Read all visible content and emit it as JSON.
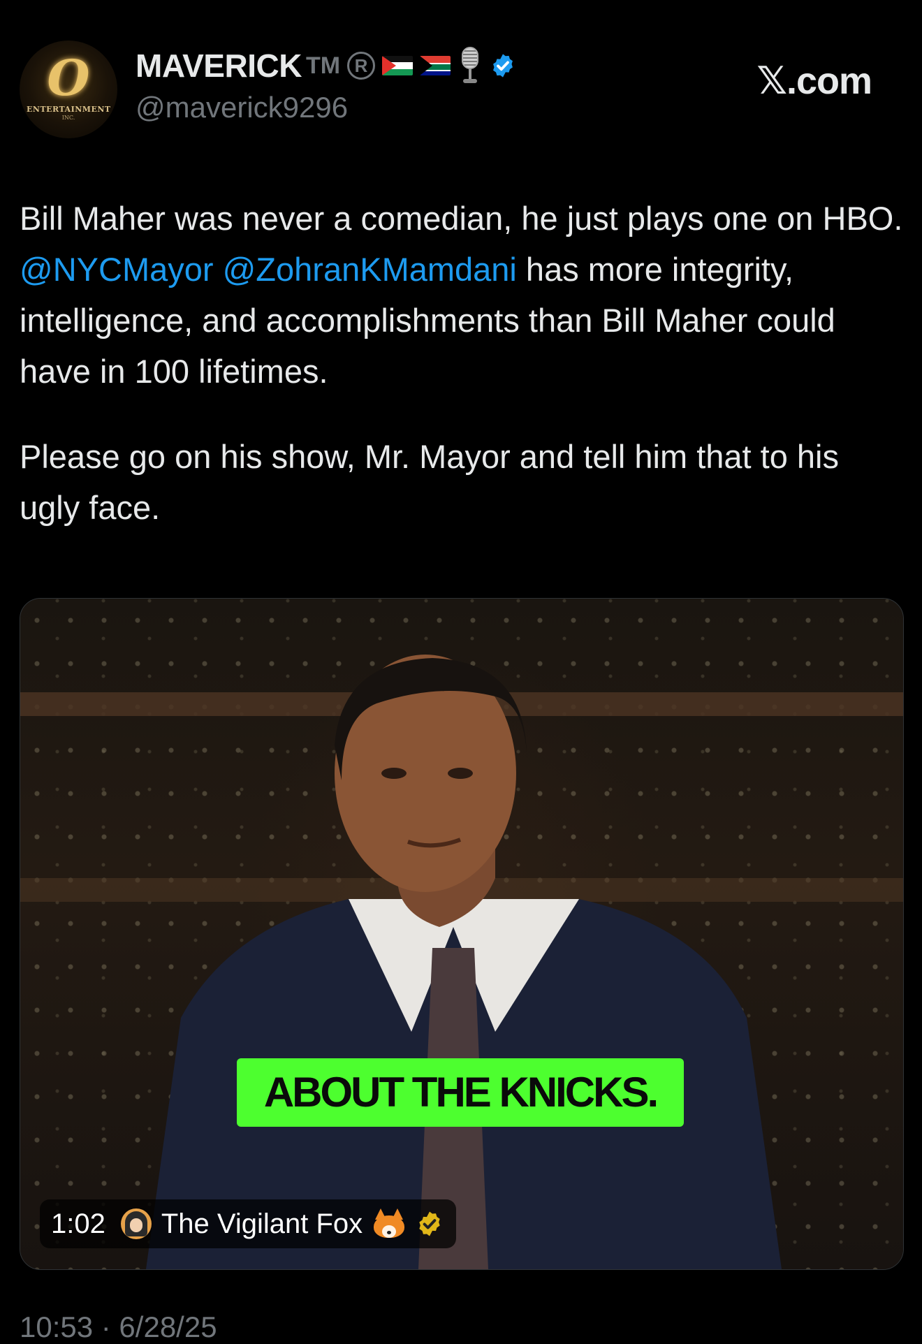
{
  "header": {
    "display_name": "MAVERICK",
    "trademark": "TM",
    "registered": "R",
    "handle": "@maverick9296",
    "avatar_logo_letter": "O",
    "avatar_logo_text": "ENTERTAINMENT",
    "avatar_logo_sub": "INC.",
    "site_label": "𝕏.com",
    "badge_colors": {
      "verified": "#1d9bf0"
    }
  },
  "tweet": {
    "paragraph1_before": "Bill Maher was never a comedian, he just plays one on HBO. ",
    "mention1": "@NYCMayor",
    "mention2": "@ZohranKMamdani",
    "paragraph1_after": " has more integrity, intelligence, and accomplishments than Bill Maher could have in 100 lifetimes.",
    "paragraph2": "Please go on his show, Mr. Mayor and tell him that to his ugly face."
  },
  "media": {
    "caption": "ABOUT THE KNICKS.",
    "duration": "1:02",
    "source_name": "The Vigilant Fox",
    "source_icons": [
      "fox-icon",
      "gold-verified-icon"
    ]
  },
  "footer": {
    "timestamp": "10:53 · 6/28/25"
  }
}
